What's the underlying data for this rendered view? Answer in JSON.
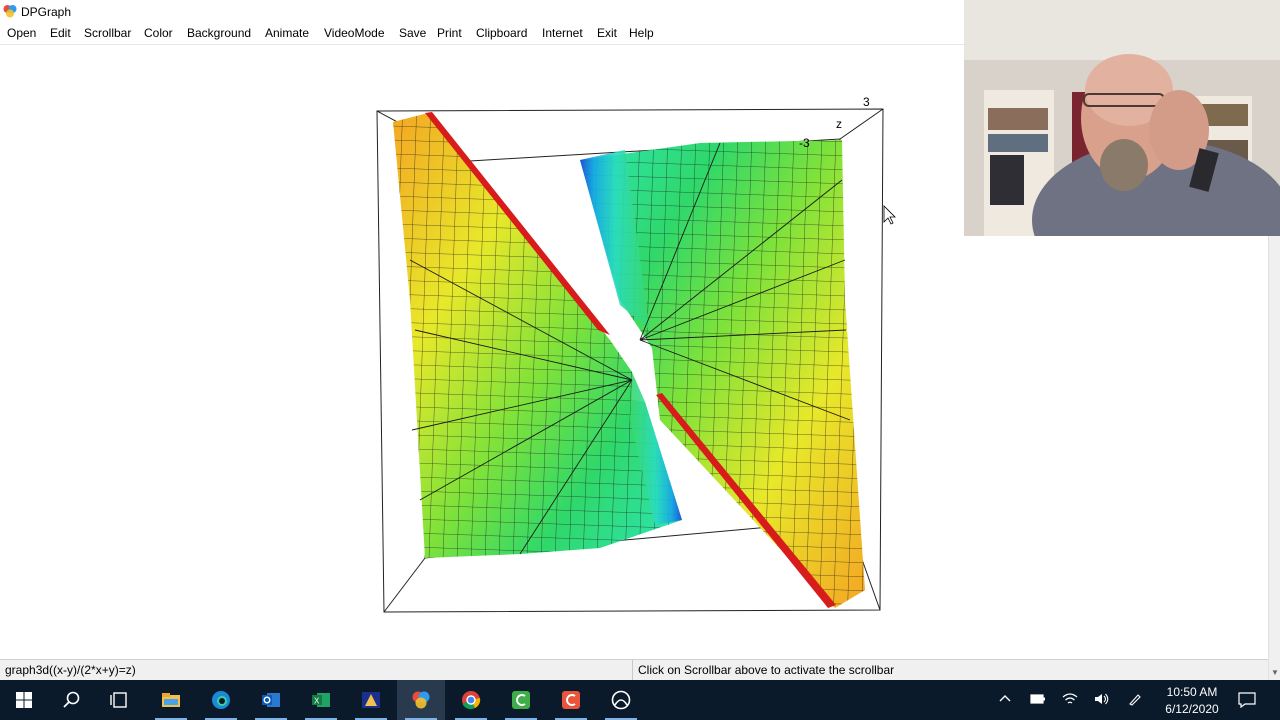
{
  "window": {
    "title": "DPGraph"
  },
  "menu": [
    "Open",
    "Edit",
    "Scrollbar",
    "Color",
    "Background",
    "Animate",
    "VideoMode",
    "Save",
    "Print",
    "Clipboard",
    "Internet",
    "Exit",
    "Help"
  ],
  "graph": {
    "axis_label_z": "z",
    "tick_top": "3",
    "tick_near": "-3"
  },
  "status": {
    "formula": "graph3d((x-y)/(2*x+y)=z)",
    "hint": "Click on Scrollbar above to activate the scrollbar"
  },
  "taskbar": {
    "apps": [
      "start-icon",
      "search-icon",
      "task-view-icon",
      "file-explorer-icon",
      "edge-icon",
      "outlook-icon",
      "excel-icon",
      "media-app-icon",
      "dpgraph-icon",
      "chrome-icon",
      "camtasia-icon",
      "camtasia-recorder-icon",
      "xbox-icon"
    ],
    "time": "10:50 AM",
    "date": "6/12/2020"
  }
}
